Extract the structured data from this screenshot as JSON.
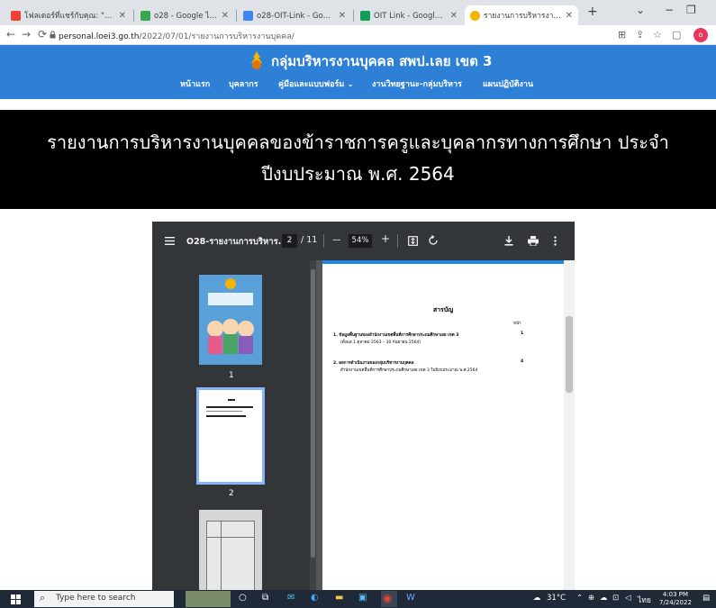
{
  "browser": {
    "tabs": [
      {
        "title": "โฟลเดอร์ที่แชร์กับคุณ: \"o28\"",
        "close": "✕",
        "color": "#ea4335"
      },
      {
        "title": "o28 - Google ไดรฟ์",
        "close": "✕",
        "color": "#34a853"
      },
      {
        "title": "o28-OIT-Link - Google ชีต",
        "close": "✕",
        "color": "#4285f4"
      },
      {
        "title": "OIT Link - Google ไดรฟ์",
        "close": "✕",
        "color": "#0f9d58"
      },
      {
        "title": "รายงานการบริหารงานบุคคลของ",
        "close": "✕",
        "color": "#f4b400"
      }
    ],
    "new_tab": "+",
    "window_controls": {
      "dropdown": "⌄",
      "minimize": "−",
      "restore": "❐"
    },
    "nav": {
      "back": "←",
      "forward": "→",
      "reload": "⟳"
    },
    "url_domain": "personal.loei3.go.th",
    "url_path": "/2022/07/01/รายงานการบริหารงานบุคคล/",
    "profile_initial": "o"
  },
  "site": {
    "title": "กลุ่มบริหารงานบุคคล สพป.เลย เขต 3",
    "menu": [
      "หน้าแรก",
      "บุคลากร",
      "คู่มือและแบบฟอร์ม ⌄",
      "งานวิทยฐานะ-กลุ่มบริหาร",
      "แผนปฏิบัติงาน"
    ],
    "banner_line1": "รายงานการบริหารงานบุคคลของข้าราชการครูและบุคลากรทางการศึกษา ประจำ",
    "banner_line2": "ปีงบประมาณ พ.ศ. 2564"
  },
  "viewer": {
    "filename": "O28-รายงานการบริหาร...",
    "page_current": "2",
    "page_total": "/ 11",
    "zoom": "54%",
    "zoom_minus": "—",
    "zoom_plus": "+",
    "thumb_labels": [
      "1",
      "2"
    ],
    "page": {
      "title": "สารบัญ",
      "column_header": "หน้า",
      "entries": [
        {
          "heading": "1. ข้อมูลพื้นฐานของสำนักงานเขตพื้นที่การศึกษาประถมศึกษาเลย เขต 3",
          "sub": "(ตั้งแต่ 1 ตุลาคม 2563 – 30 กันยายน 2564)",
          "page": "1"
        },
        {
          "heading": "2. ผลการดำเนินงานของกลุ่มบริหารงานบุคคล",
          "sub": "สำนักงานเขตพื้นที่การศึกษาประถมศึกษาเลย เขต 3 ในปีงบประมาณ พ.ศ.2564",
          "page": "4"
        }
      ]
    }
  },
  "taskbar": {
    "search_placeholder": "Type here to search",
    "temperature": "31°C",
    "lang": "ไทย",
    "time": "4:03 PM",
    "date": "7/24/2022"
  }
}
